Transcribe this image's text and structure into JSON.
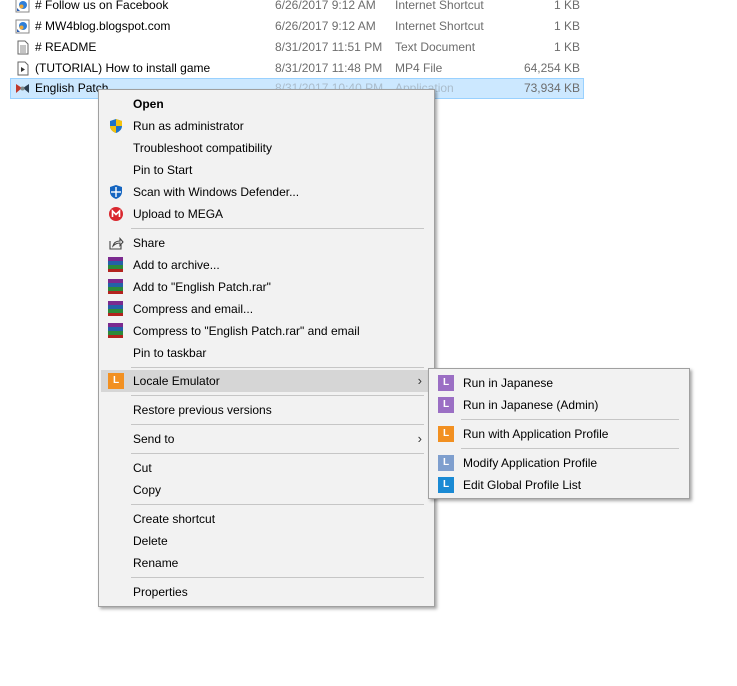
{
  "files": [
    {
      "name": "# Follow us on Facebook",
      "date": "6/26/2017 9:12 AM",
      "type": "Internet Shortcut",
      "size": "1 KB",
      "icon": "internet-shortcut-icon"
    },
    {
      "name": "# MW4blog.blogspot.com",
      "date": "6/26/2017 9:12 AM",
      "type": "Internet Shortcut",
      "size": "1 KB",
      "icon": "internet-shortcut-icon"
    },
    {
      "name": "# README",
      "date": "8/31/2017 11:51 PM",
      "type": "Text Document",
      "size": "1 KB",
      "icon": "text-document-icon"
    },
    {
      "name": "(TUTORIAL) How to install game",
      "date": "8/31/2017 11:48 PM",
      "type": "MP4 File",
      "size": "64,254 KB",
      "icon": "video-file-icon"
    },
    {
      "name": "English Patch",
      "date": "8/31/2017 10:40 PM",
      "type": "Application",
      "size": "73,934 KB",
      "icon": "application-icon",
      "selected": true
    }
  ],
  "context_menu": {
    "items": [
      {
        "label": "Open",
        "bold": true
      },
      {
        "label": "Run as administrator",
        "icon": "uac-shield-icon"
      },
      {
        "label": "Troubleshoot compatibility"
      },
      {
        "label": "Pin to Start"
      },
      {
        "label": "Scan with Windows Defender...",
        "icon": "windows-defender-icon"
      },
      {
        "label": "Upload to MEGA",
        "icon": "mega-icon"
      },
      {
        "label": "Share",
        "icon": "share-icon"
      },
      {
        "label": "Add to archive...",
        "icon": "winrar-icon"
      },
      {
        "label": "Add to \"English Patch.rar\"",
        "icon": "winrar-icon"
      },
      {
        "label": "Compress and email...",
        "icon": "winrar-icon"
      },
      {
        "label": "Compress to \"English Patch.rar\" and email",
        "icon": "winrar-icon"
      },
      {
        "label": "Pin to taskbar"
      },
      {
        "label": "Locale Emulator",
        "icon": "locale-emulator-icon",
        "submenu": true,
        "highlighted": true
      },
      {
        "label": "Restore previous versions"
      },
      {
        "label": "Send to",
        "submenu": true
      },
      {
        "label": "Cut"
      },
      {
        "label": "Copy"
      },
      {
        "label": "Create shortcut"
      },
      {
        "label": "Delete"
      },
      {
        "label": "Rename"
      },
      {
        "label": "Properties"
      }
    ]
  },
  "submenu": {
    "items": [
      {
        "label": "Run in Japanese",
        "icon_letter": "L",
        "icon_color": "#9b6fc4"
      },
      {
        "label": "Run in Japanese (Admin)",
        "icon_letter": "L",
        "icon_color": "#9b6fc4"
      },
      {
        "label": "Run with Application Profile",
        "icon_letter": "L",
        "icon_color": "#f29021"
      },
      {
        "label": "Modify Application Profile",
        "icon_letter": "L",
        "icon_color": "#7f9fce"
      },
      {
        "label": "Edit Global Profile List",
        "icon_letter": "L",
        "icon_color": "#1a8ad4"
      }
    ]
  },
  "colors": {
    "selection": "#cce8ff",
    "menu_bg": "#f2f2f2",
    "menu_hover": "#d6d6d6",
    "locale_emulator_orange": "#f29021"
  },
  "arrow_glyph": "›"
}
